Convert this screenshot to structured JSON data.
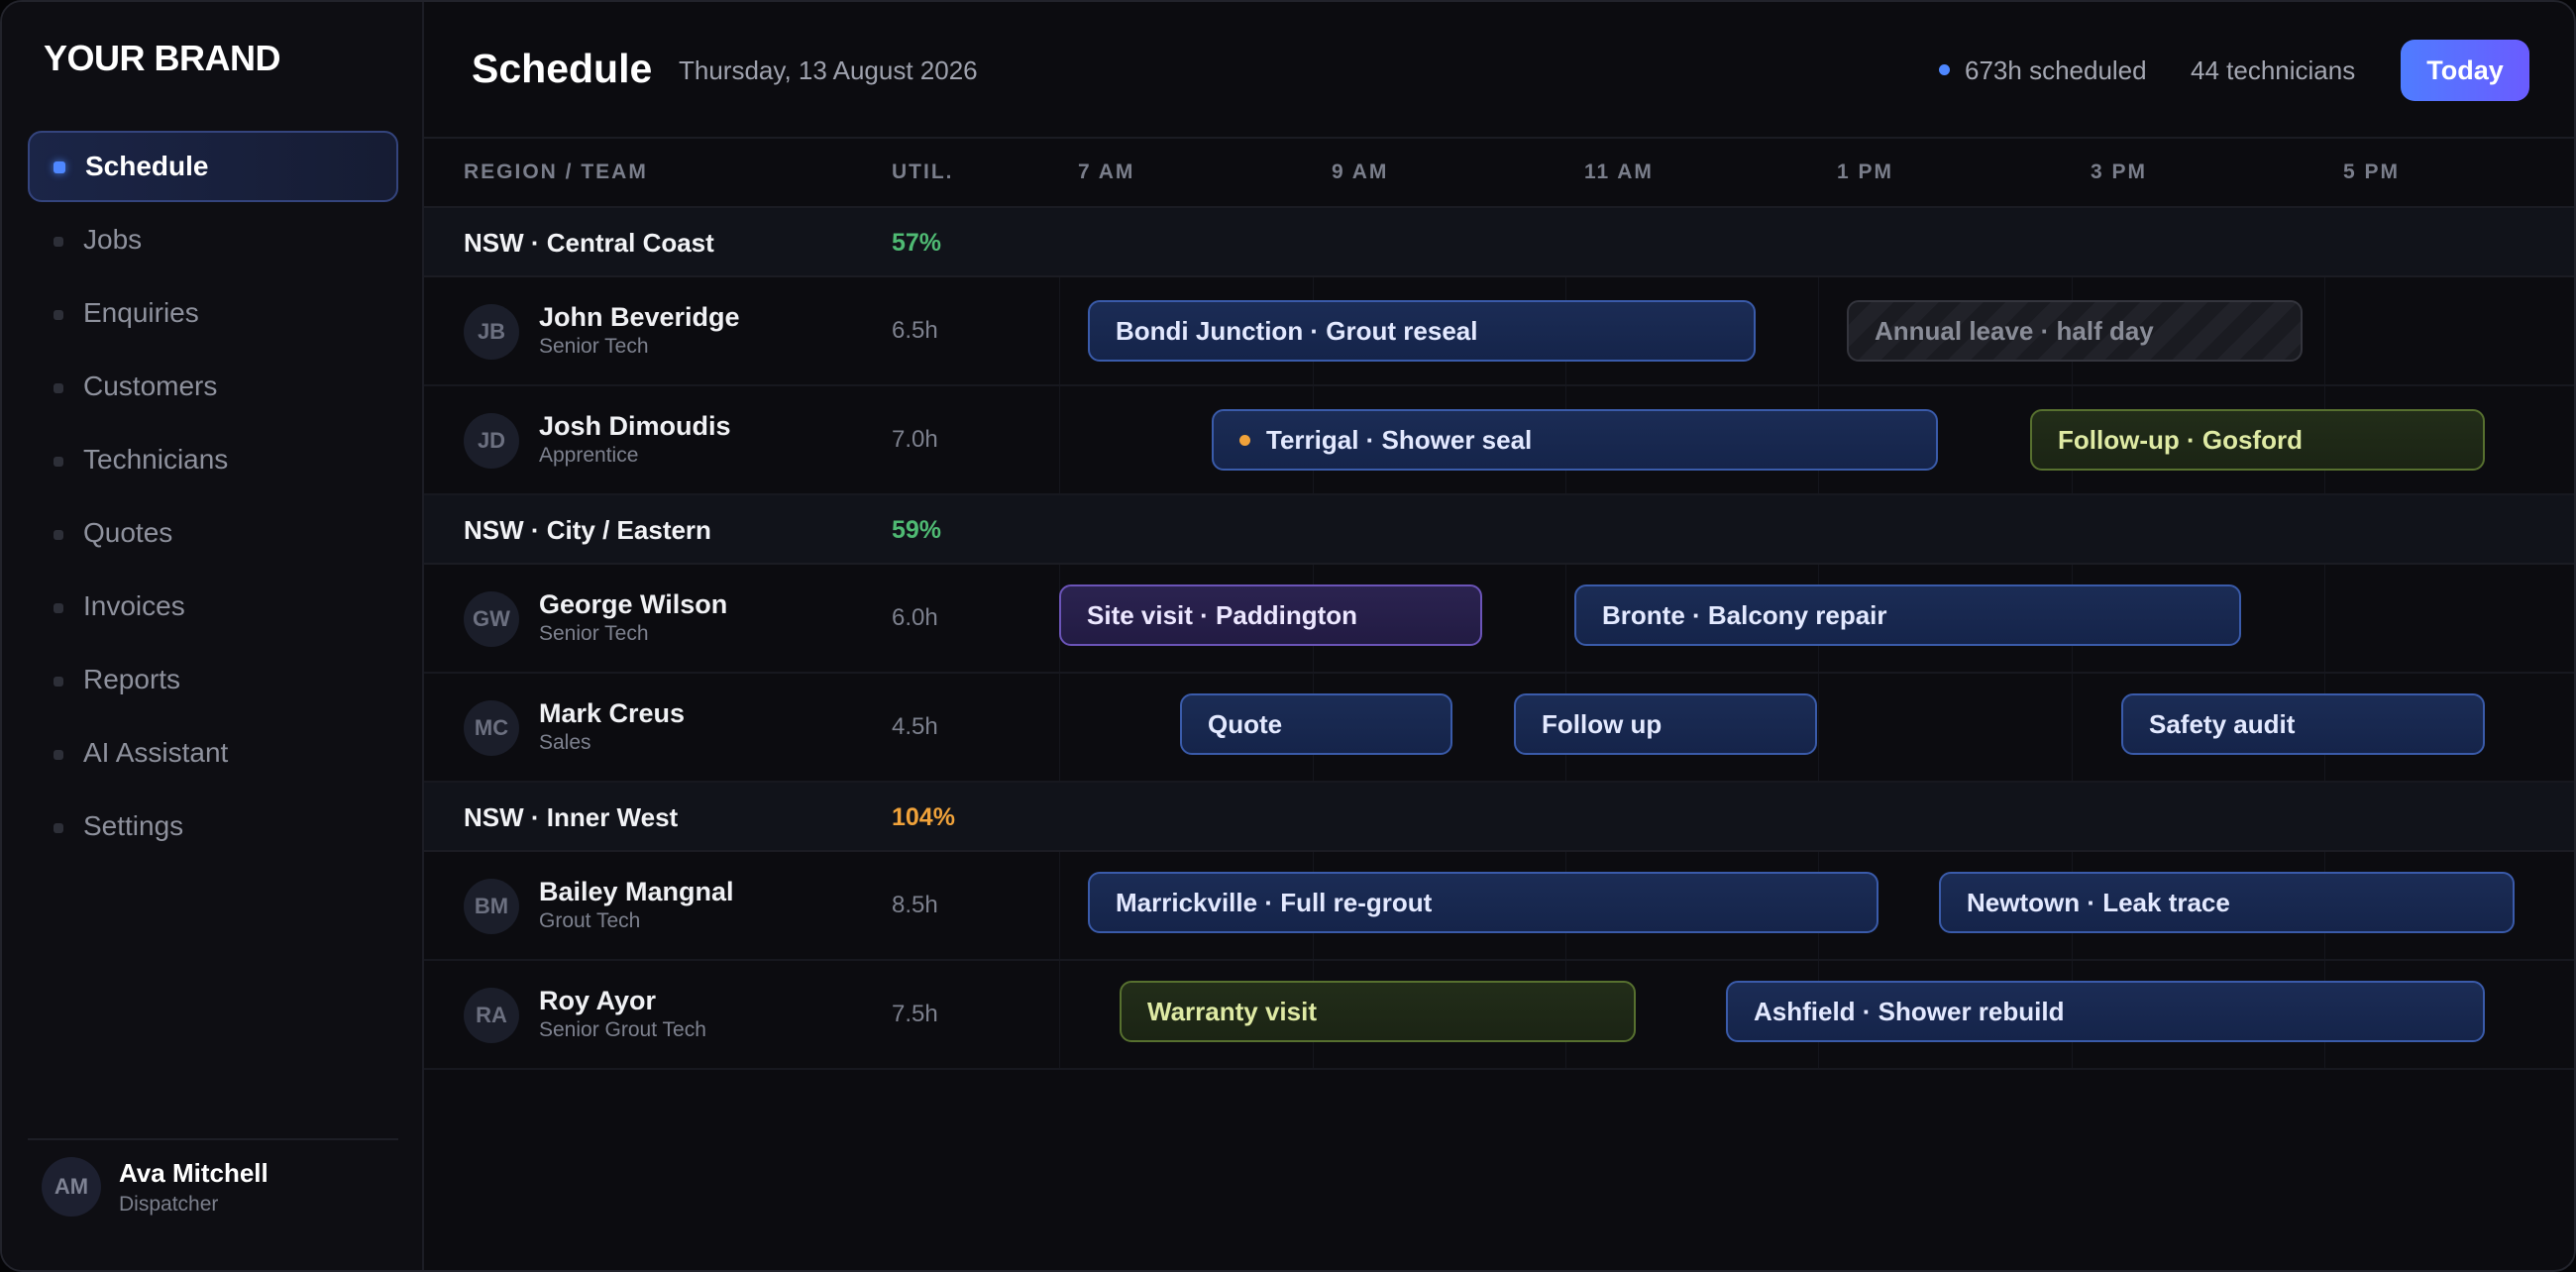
{
  "brand": "YOUR BRAND",
  "nav": [
    {
      "label": "Schedule",
      "active": true
    },
    {
      "label": "Jobs"
    },
    {
      "label": "Enquiries"
    },
    {
      "label": "Customers"
    },
    {
      "label": "Technicians"
    },
    {
      "label": "Quotes"
    },
    {
      "label": "Invoices"
    },
    {
      "label": "Reports"
    },
    {
      "label": "AI Assistant"
    },
    {
      "label": "Settings"
    }
  ],
  "user": {
    "initials": "AM",
    "name": "Ava Mitchell",
    "role": "Dispatcher"
  },
  "header": {
    "title": "Schedule",
    "date": "Thursday, 13 August 2026",
    "hours": "673h scheduled",
    "technicians": "44 technicians",
    "today_label": "Today"
  },
  "columns": {
    "region": "REGION / TEAM",
    "util": "UTIL.",
    "times": [
      "7 AM",
      "9 AM",
      "11 AM",
      "1 PM",
      "3 PM",
      "5 PM"
    ]
  },
  "colors": {
    "accent": "#4e87ff",
    "util_ok": "#4fba73",
    "util_over": "#f0a23a",
    "job": "#3a5baa",
    "visit": "#6b54b8",
    "followup": "#57702f"
  },
  "groups": [
    {
      "name": "NSW · Central Coast",
      "util": "57%",
      "util_status": "ok",
      "techs": [
        {
          "initials": "JB",
          "name": "John Beveridge",
          "role": "Senior Tech",
          "hours": "6.5h",
          "blocks": [
            {
              "label": "Bondi Junction · Grout reseal",
              "kind": "job"
            },
            {
              "label": "Annual leave · half day",
              "kind": "leave"
            }
          ]
        },
        {
          "initials": "JD",
          "name": "Josh Dimoudis",
          "role": "Apprentice",
          "hours": "7.0h",
          "blocks": [
            {
              "label": "Terrigal · Shower seal",
              "kind": "job",
              "flag": true
            },
            {
              "label": "Follow-up · Gosford",
              "kind": "followup"
            }
          ]
        }
      ]
    },
    {
      "name": "NSW · City / Eastern",
      "util": "59%",
      "util_status": "ok",
      "techs": [
        {
          "initials": "GW",
          "name": "George Wilson",
          "role": "Senior Tech",
          "hours": "6.0h",
          "blocks": [
            {
              "label": "Site visit · Paddington",
              "kind": "visit"
            },
            {
              "label": "Bronte · Balcony repair",
              "kind": "job"
            }
          ]
        },
        {
          "initials": "MC",
          "name": "Mark Creus",
          "role": "Sales",
          "hours": "4.5h",
          "blocks": [
            {
              "label": "Quote",
              "kind": "job"
            },
            {
              "label": "Follow up",
              "kind": "job"
            },
            {
              "label": "Safety audit",
              "kind": "job"
            }
          ]
        }
      ]
    },
    {
      "name": "NSW · Inner West",
      "util": "104%",
      "util_status": "over",
      "techs": [
        {
          "initials": "BM",
          "name": "Bailey Mangnal",
          "role": "Grout Tech",
          "hours": "8.5h",
          "blocks": [
            {
              "label": "Marrickville · Full re-grout",
              "kind": "job"
            },
            {
              "label": "Newtown · Leak trace",
              "kind": "job"
            }
          ]
        },
        {
          "initials": "RA",
          "name": "Roy Ayor",
          "role": "Senior Grout Tech",
          "hours": "7.5h",
          "blocks": [
            {
              "label": "Warranty visit",
              "kind": "followup"
            },
            {
              "label": "Ashfield · Shower rebuild",
              "kind": "job"
            }
          ]
        }
      ]
    }
  ]
}
